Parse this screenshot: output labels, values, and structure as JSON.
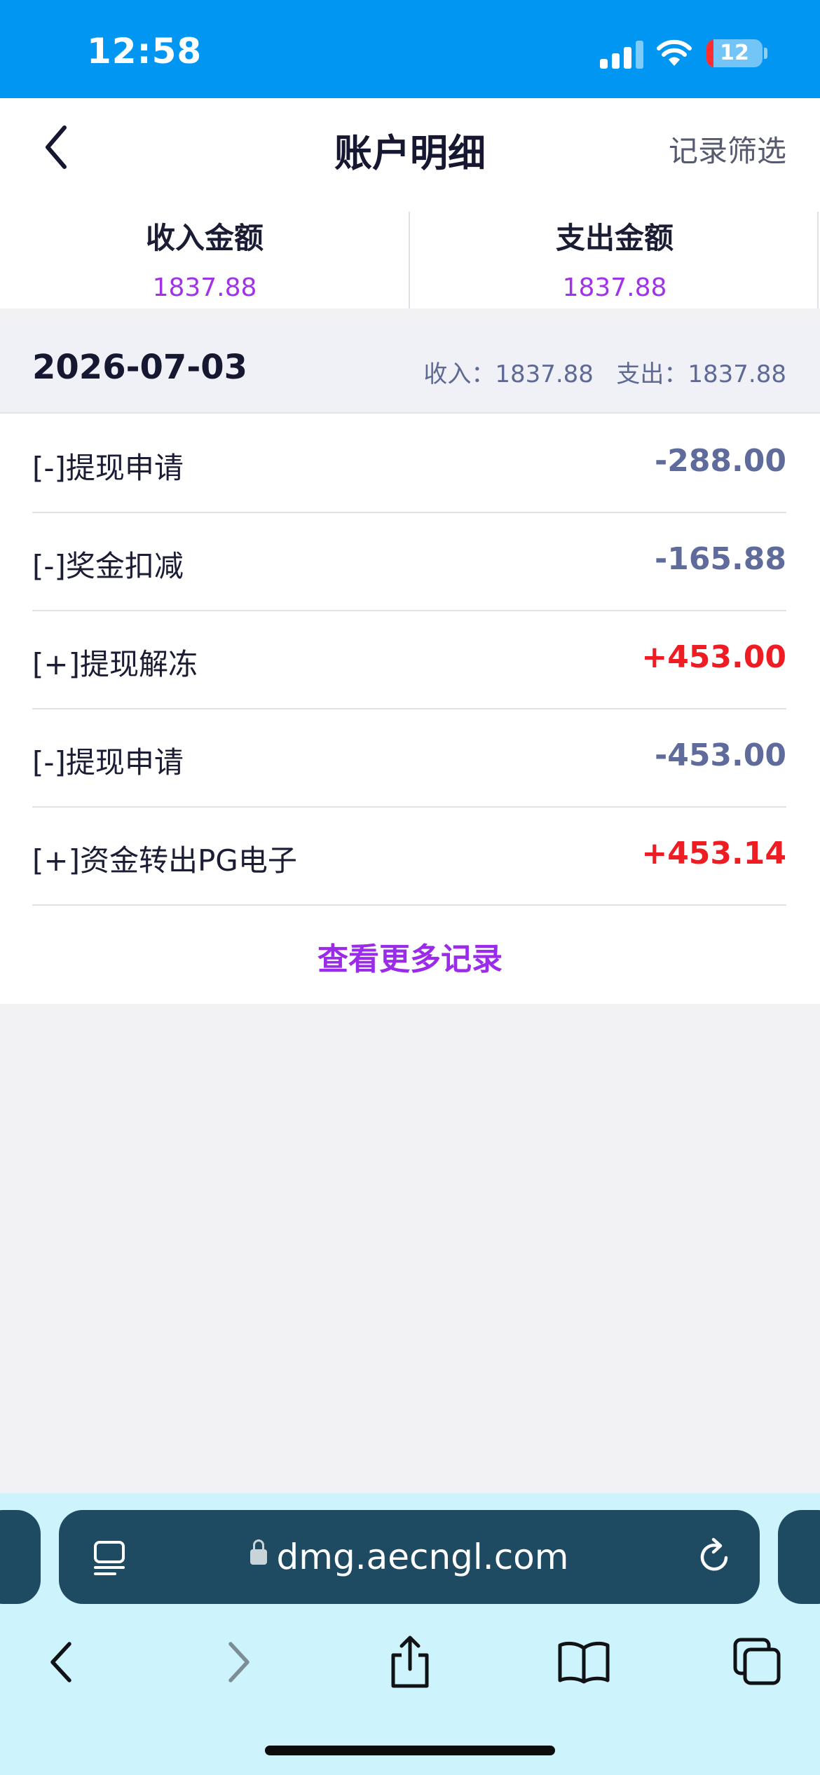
{
  "status_bar": {
    "time": "12:58",
    "battery": "12",
    "battery_level": 0.12
  },
  "header": {
    "title": "账户明细",
    "filter_label": "记录筛选"
  },
  "summary": {
    "income_label": "收入金额",
    "income_value": "1837.88",
    "expense_label": "支出金额",
    "expense_value": "1837.88"
  },
  "date_group": {
    "date": "2026-07-03",
    "income_label": "收入：",
    "income_value": "1837.88",
    "expense_label": "支出：",
    "expense_value": "1837.88"
  },
  "records": [
    {
      "label": "[-]提现申请",
      "amount": "-288.00",
      "type": "expense"
    },
    {
      "label": "[-]奖金扣减",
      "amount": "-165.88",
      "type": "expense"
    },
    {
      "label": "[+]提现解冻",
      "amount": "+453.00",
      "type": "income"
    },
    {
      "label": "[-]提现申请",
      "amount": "-453.00",
      "type": "expense"
    },
    {
      "label": "[+]资金转出PG电子",
      "amount": "+453.14",
      "type": "income"
    }
  ],
  "more_label": "查看更多记录",
  "browser": {
    "url": "dmg.aecngl.com"
  },
  "colors": {
    "status_bar": "#0196f2",
    "accent_purple": "#a033e8",
    "income_red": "#f01c24",
    "expense_gray": "#5f6c9b"
  },
  "icons": [
    "signal-icon",
    "wifi-icon",
    "battery-icon",
    "back-arrow-icon",
    "tabs-icon",
    "lock-icon",
    "reload-icon",
    "browser-back-icon",
    "browser-forward-icon",
    "share-icon",
    "bookmarks-icon",
    "tab-switcher-icon"
  ]
}
